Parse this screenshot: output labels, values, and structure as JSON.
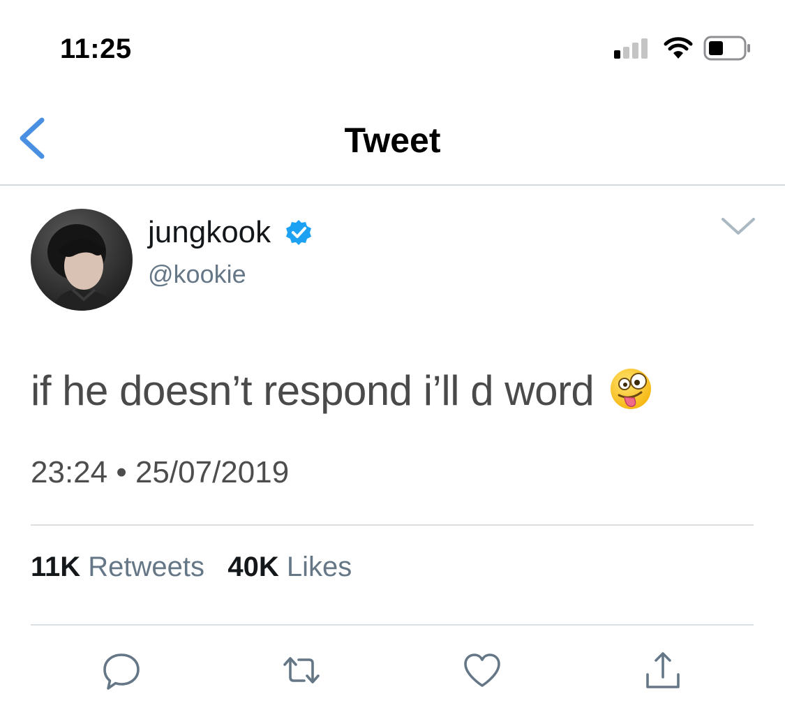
{
  "status_bar": {
    "time": "11:25",
    "signal_icon": "signal-bars-icon",
    "wifi_icon": "wifi-icon",
    "battery_icon": "battery-icon"
  },
  "nav": {
    "back_icon": "chevron-left-icon",
    "title": "Tweet"
  },
  "tweet": {
    "author": {
      "name": "jungkook",
      "handle": "@kookie",
      "verified": true,
      "avatar_icon": "avatar"
    },
    "text": "if he doesn’t respond i’ll d word",
    "emoji": "zany-face-icon",
    "timestamp": "23:24 • 25/07/2019",
    "retweets_count": "11K",
    "retweets_label": "Retweets",
    "likes_count": "40K",
    "likes_label": "Likes"
  },
  "actions": [
    {
      "name": "reply",
      "icon": "comment-icon"
    },
    {
      "name": "retweet",
      "icon": "retweet-icon"
    },
    {
      "name": "like",
      "icon": "heart-icon"
    },
    {
      "name": "share",
      "icon": "share-icon"
    }
  ],
  "colors": {
    "accent": "#4a90e2",
    "verified": "#1da1f2",
    "secondary_text": "#657786",
    "divider": "#dcdfe2"
  }
}
